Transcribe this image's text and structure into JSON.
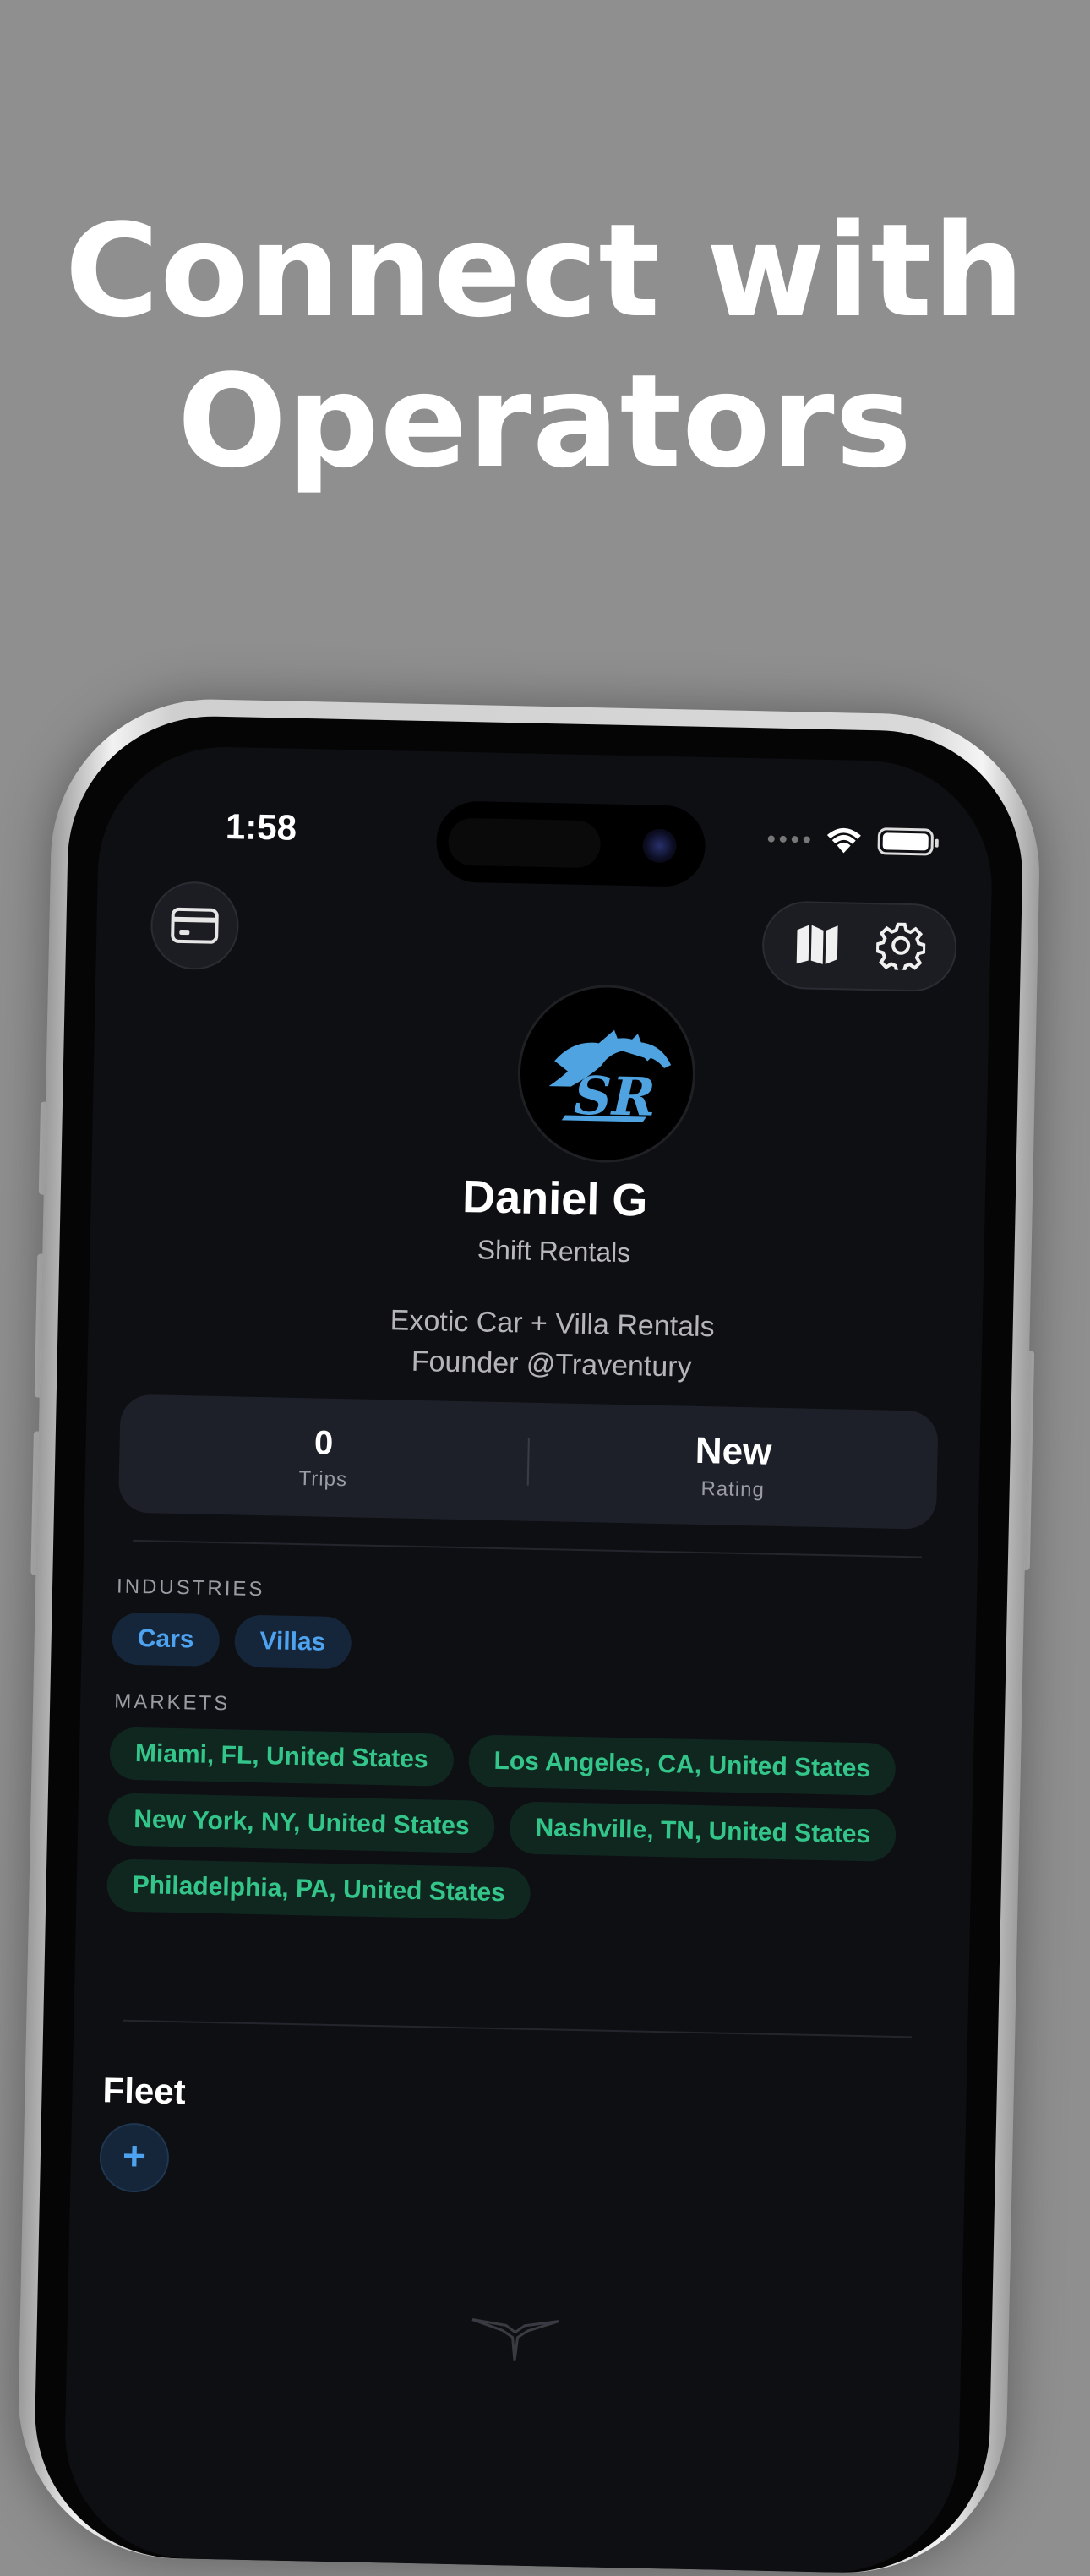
{
  "headline": {
    "line1": "Connect with",
    "line2": "Operators"
  },
  "status_bar": {
    "time": "1:58"
  },
  "toolbar": {
    "wallet_icon": "credit-card-icon",
    "map_icon": "map-icon",
    "settings_icon": "gear-icon"
  },
  "profile": {
    "avatar_text": "SR",
    "name": "Daniel G",
    "company": "Shift Rentals",
    "bio_line1": "Exotic Car + Villa Rentals",
    "bio_line2": "Founder @Traventury"
  },
  "stats": [
    {
      "value": "0",
      "label": "Trips"
    },
    {
      "value": "New",
      "label": "Rating"
    }
  ],
  "industries": {
    "label": "INDUSTRIES",
    "items": [
      "Cars",
      "Villas"
    ]
  },
  "markets": {
    "label": "MARKETS",
    "items": [
      "Miami, FL, United States",
      "Los Angeles, CA, United States",
      "New York, NY, United States",
      "Nashville, TN, United States",
      "Philadelphia, PA, United States"
    ]
  },
  "fleet": {
    "title": "Fleet",
    "add_label": "+"
  },
  "colors": {
    "background": "#8f8f8f",
    "screen": "#0e0f13",
    "accent_blue": "#4ea3f0",
    "accent_green": "#33c58a"
  }
}
